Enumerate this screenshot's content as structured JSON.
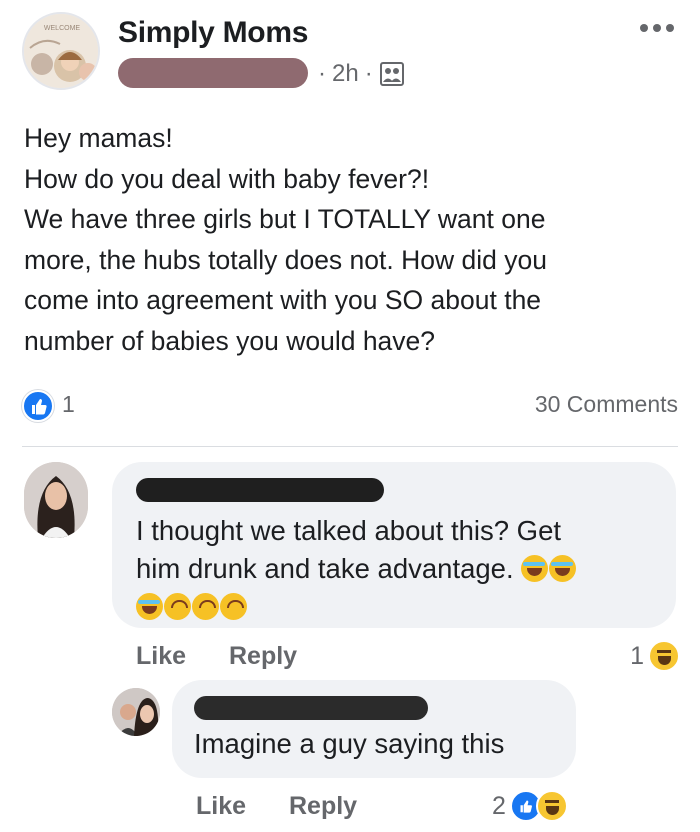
{
  "post": {
    "group_name": "Simply Moms",
    "time": "2h",
    "separator": "·",
    "body_lines": [
      "Hey mamas!",
      "How do you deal with baby fever?!",
      "We have three girls but I TOTALLY want one",
      "more, the hubs totally does not. How did you",
      "come into agreement with you SO about the",
      "number of babies you would have?"
    ],
    "reaction_count": "1",
    "comments_label": "30 Comments"
  },
  "comments": [
    {
      "text": "I thought we talked about this? Get him drunk and take advantage.",
      "line1": "I thought we talked about this? Get",
      "line2": "him drunk and take advantage.",
      "like_label": "Like",
      "reply_label": "Reply",
      "reaction_count": "1"
    },
    {
      "text": "Imagine a guy saying this",
      "like_label": "Like",
      "reply_label": "Reply",
      "reaction_count": "2"
    }
  ],
  "colors": {
    "facebook_blue": "#1877f2",
    "bubble_gray": "#f0f2f5",
    "meta_gray": "#65676b",
    "redacted_name_pink": "#8f6a70"
  },
  "icons": [
    "more-options-icon",
    "audience-members-icon",
    "like-reaction-icon",
    "haha-reaction-icon",
    "rolling-laughing-emoji-icon",
    "upside-down-face-emoji-icon"
  ]
}
